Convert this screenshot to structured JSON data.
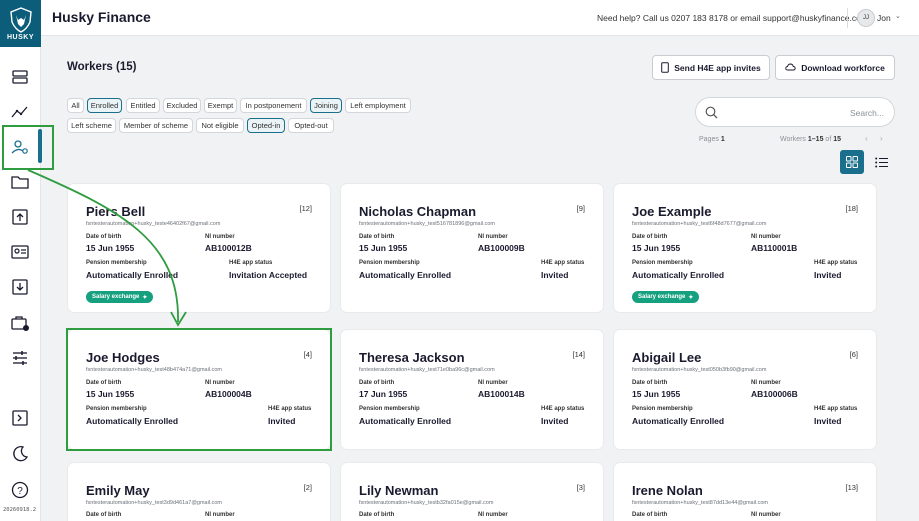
{
  "app": {
    "brand": "HUSKY",
    "title": "Husky Finance",
    "help_text": "Need help? Call us 0207 183 8178 or email support@huskyfinance.com",
    "user_initials": "JJ",
    "user_name": "Jon",
    "version": "20260918.2"
  },
  "sidebar": {
    "items": [
      {
        "name": "dashboard-icon"
      },
      {
        "name": "analytics-icon"
      },
      {
        "name": "workers-icon",
        "active": true
      },
      {
        "name": "folder-icon"
      },
      {
        "name": "upload-icon"
      },
      {
        "name": "id-card-icon"
      },
      {
        "name": "download-icon"
      },
      {
        "name": "briefcase-icon"
      },
      {
        "name": "settings-sliders-icon"
      },
      {
        "name": "collapse-sidebar-icon"
      },
      {
        "name": "dark-mode-icon"
      },
      {
        "name": "help-icon"
      }
    ]
  },
  "workers": {
    "title": "Workers (15)",
    "send_invites_label": "Send H4E app invites",
    "download_label": "Download workforce"
  },
  "filters": {
    "row1": [
      "All",
      "Enrolled",
      "Entitled",
      "Excluded",
      "Exempt",
      "In postponement",
      "Joining",
      "Left employment"
    ],
    "row2": [
      "Left scheme",
      "Member of scheme",
      "Not eligible",
      "Opted-in",
      "Opted-out"
    ],
    "active": [
      "Enrolled",
      "Joining",
      "Opted-in"
    ]
  },
  "search": {
    "placeholder": "Search..."
  },
  "paging": {
    "pages_label": "Pages",
    "pages_value": "1",
    "workers_label": "Workers",
    "workers_range": "1–15",
    "of_label": "of",
    "workers_total": "15"
  },
  "card_labels": {
    "dob": "Date of birth",
    "ni": "NI number",
    "pension": "Pension membership",
    "app_status": "H4E app status"
  },
  "cards": [
    {
      "name": "Piers Bell",
      "id": "[12]",
      "email": "fsntesterautomation+husky_teste46402f67@gmail.com",
      "dob": "15 Jun 1955",
      "ni": "AB100012B",
      "pension": "Automatically Enrolled",
      "app_status": "Invitation Accepted",
      "badge": "Salary exchange"
    },
    {
      "name": "Nicholas Chapman",
      "id": "[9]",
      "email": "fsntesterautomation+husky_test516781896@gmail.com",
      "dob": "15 Jun 1955",
      "ni": "AB100009B",
      "pension": "Automatically Enrolled",
      "app_status": "Invited",
      "badge": ""
    },
    {
      "name": "Joe Example",
      "id": "[18]",
      "email": "fsntesterautomation+husky_test6f48d7677@gmail.com",
      "dob": "15 Jun 1955",
      "ni": "AB110001B",
      "pension": "Automatically Enrolled",
      "app_status": "Invited",
      "badge": "Salary exchange"
    },
    {
      "name": "Joe Hodges",
      "id": "[4]",
      "email": "fsntesterautomation+husky_test48b474a71@gmail.com",
      "dob": "15 Jun 1955",
      "ni": "AB100004B",
      "pension": "Automatically Enrolled",
      "app_status": "Invited",
      "badge": ""
    },
    {
      "name": "Theresa Jackson",
      "id": "[14]",
      "email": "fsntesterautomation+husky_test71e0ba96c@gmail.com",
      "dob": "17 Jun 1955",
      "ni": "AB100014B",
      "pension": "Automatically Enrolled",
      "app_status": "Invited",
      "badge": ""
    },
    {
      "name": "Abigail Lee",
      "id": "[6]",
      "email": "fsntesterautomation+husky_test050b3fb90@gmail.com",
      "dob": "15 Jun 1955",
      "ni": "AB100006B",
      "pension": "Automatically Enrolled",
      "app_status": "Invited",
      "badge": ""
    },
    {
      "name": "Emily May",
      "id": "[2]",
      "email": "fsntesterautomation+husky_test3d9d461a7@gmail.com",
      "dob": "",
      "ni": "",
      "pension": "",
      "app_status": "",
      "badge": ""
    },
    {
      "name": "Lily Newman",
      "id": "[3]",
      "email": "fsntesterautomation+husky_testb32fa015e@gmail.com",
      "dob": "",
      "ni": "",
      "pension": "",
      "app_status": "",
      "badge": ""
    },
    {
      "name": "Irene Nolan",
      "id": "[13]",
      "email": "fsntesterautomation+husky_test87dd13e44@gmail.com",
      "dob": "",
      "ni": "",
      "pension": "",
      "app_status": "",
      "badge": ""
    }
  ],
  "colors": {
    "brand": "#0b5d7a",
    "accent": "#1a6f8c",
    "badge": "#15a07f",
    "annotation": "#2f9c3f"
  }
}
